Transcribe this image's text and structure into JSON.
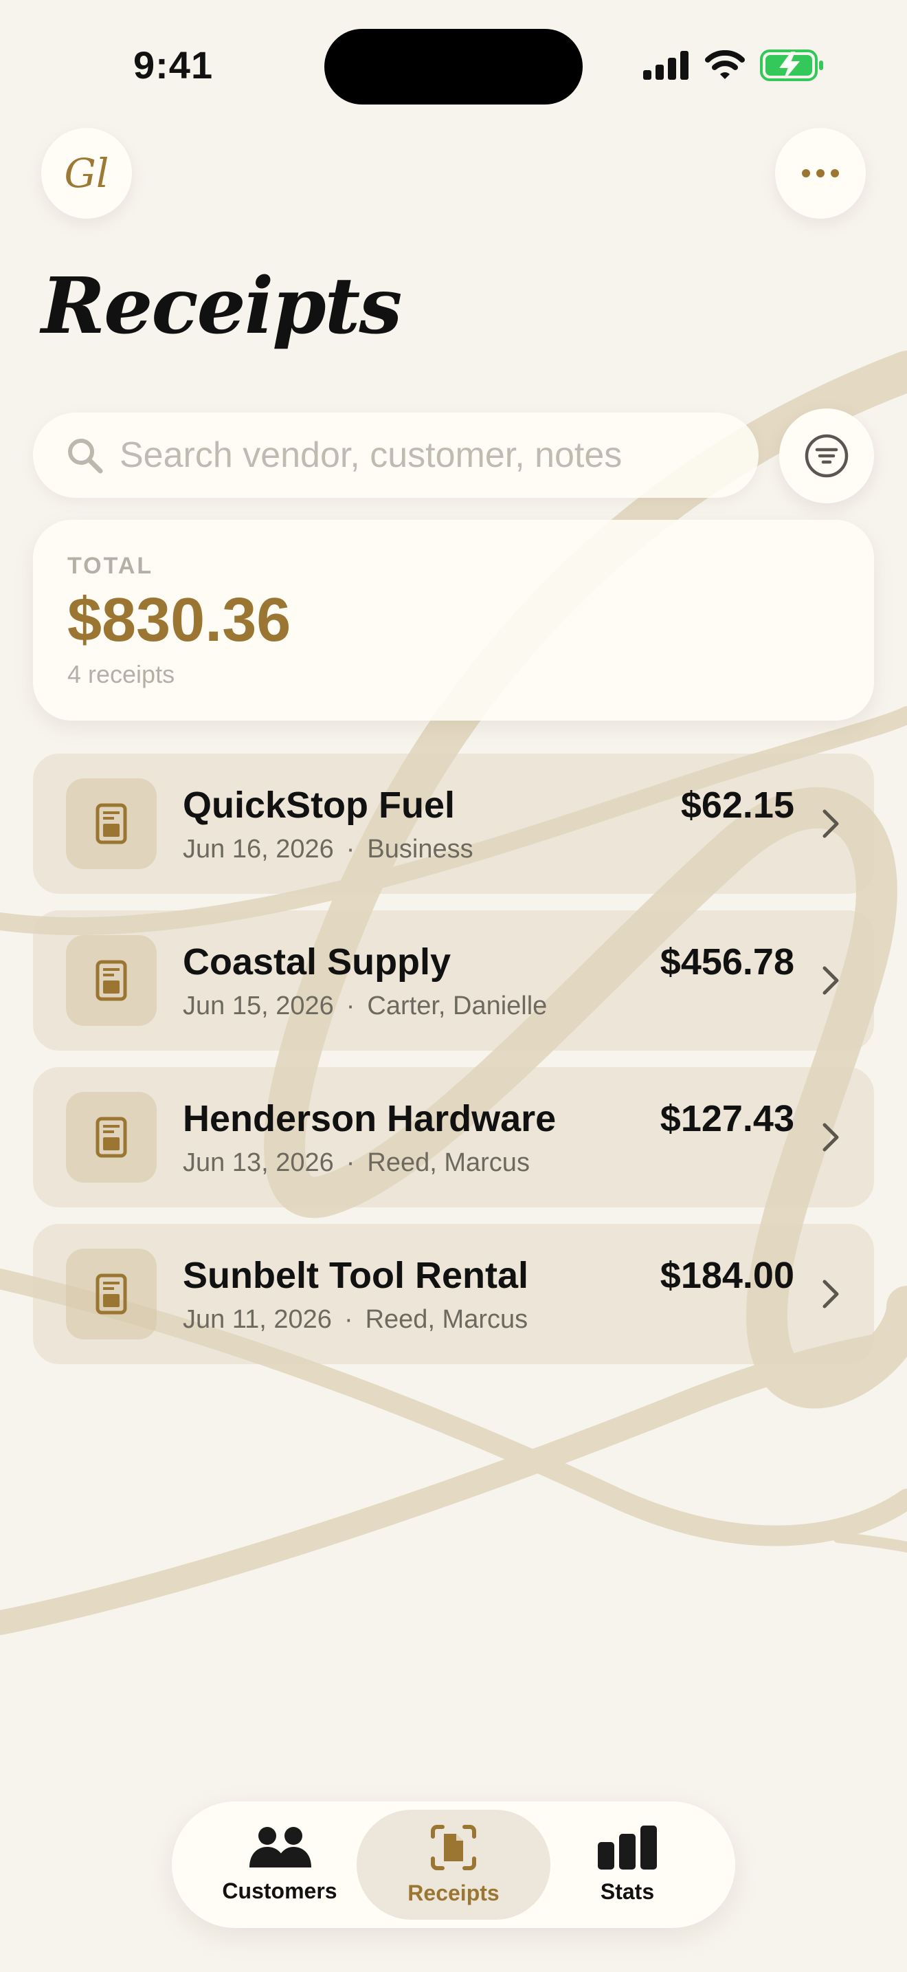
{
  "status_bar": {
    "time": "9:41"
  },
  "header": {
    "logo_text": "Gl",
    "title": "Receipts"
  },
  "search": {
    "placeholder": "Search vendor, customer, notes",
    "value": ""
  },
  "summary": {
    "label": "TOTAL",
    "amount": "$830.36",
    "count": "4 receipts"
  },
  "receipts": [
    {
      "vendor": "QuickStop Fuel",
      "date": "Jun 16, 2026",
      "separator": "·",
      "tag": "Business",
      "amount": "$62.15"
    },
    {
      "vendor": "Coastal Supply",
      "date": "Jun 15, 2026",
      "separator": "·",
      "tag": "Carter, Danielle",
      "amount": "$456.78"
    },
    {
      "vendor": "Henderson Hardware",
      "date": "Jun 13, 2026",
      "separator": "·",
      "tag": "Reed, Marcus",
      "amount": "$127.43"
    },
    {
      "vendor": "Sunbelt Tool Rental",
      "date": "Jun 11, 2026",
      "separator": "·",
      "tag": "Reed, Marcus",
      "amount": "$184.00"
    }
  ],
  "tabs": [
    {
      "label": "Customers",
      "icon": "people-icon",
      "active": false
    },
    {
      "label": "Receipts",
      "icon": "receipt-scan-icon",
      "active": true
    },
    {
      "label": "Stats",
      "icon": "bar-chart-icon",
      "active": false
    }
  ],
  "colors": {
    "accent": "#9a7632",
    "background": "#f7f4ee",
    "battery": "#34c759"
  }
}
